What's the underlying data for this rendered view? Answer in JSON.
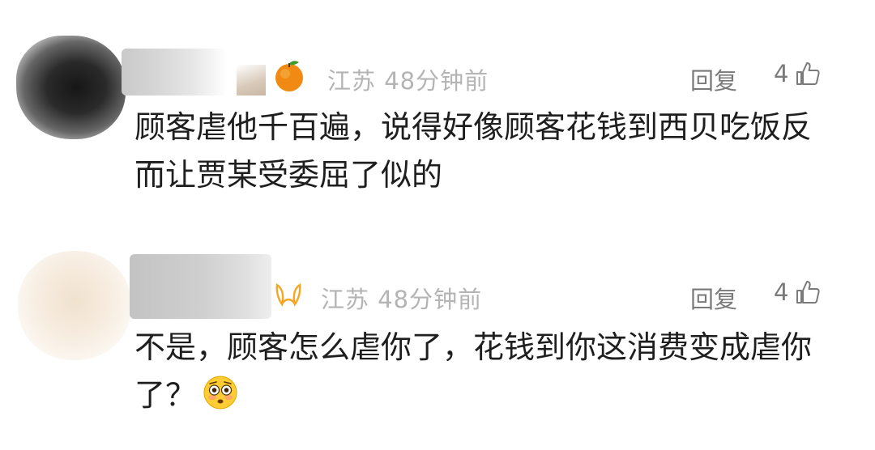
{
  "comments": [
    {
      "location": "江苏",
      "time": "48分钟前",
      "reply_label": "回复",
      "like_count": "4",
      "content": "顾客虐他千百遍，说得好像顾客花钱到西贝吃饭反而让贾某受委屈了似的",
      "badge": "orange-fruit-icon"
    },
    {
      "location": "江苏",
      "time": "48分钟前",
      "reply_label": "回复",
      "like_count": "4",
      "content": "不是，顾客怎么虐你了，花钱到你这消费变成虐你了？",
      "badge": "orange-ribbon-icon",
      "trailing_emoji": "flushed-face-emoji"
    }
  ],
  "colors": {
    "meta_text": "#b4b4b4",
    "action_text": "#7a7a7a",
    "body_text": "#1e1e1e",
    "badge_ribbon": "#f5a623"
  }
}
